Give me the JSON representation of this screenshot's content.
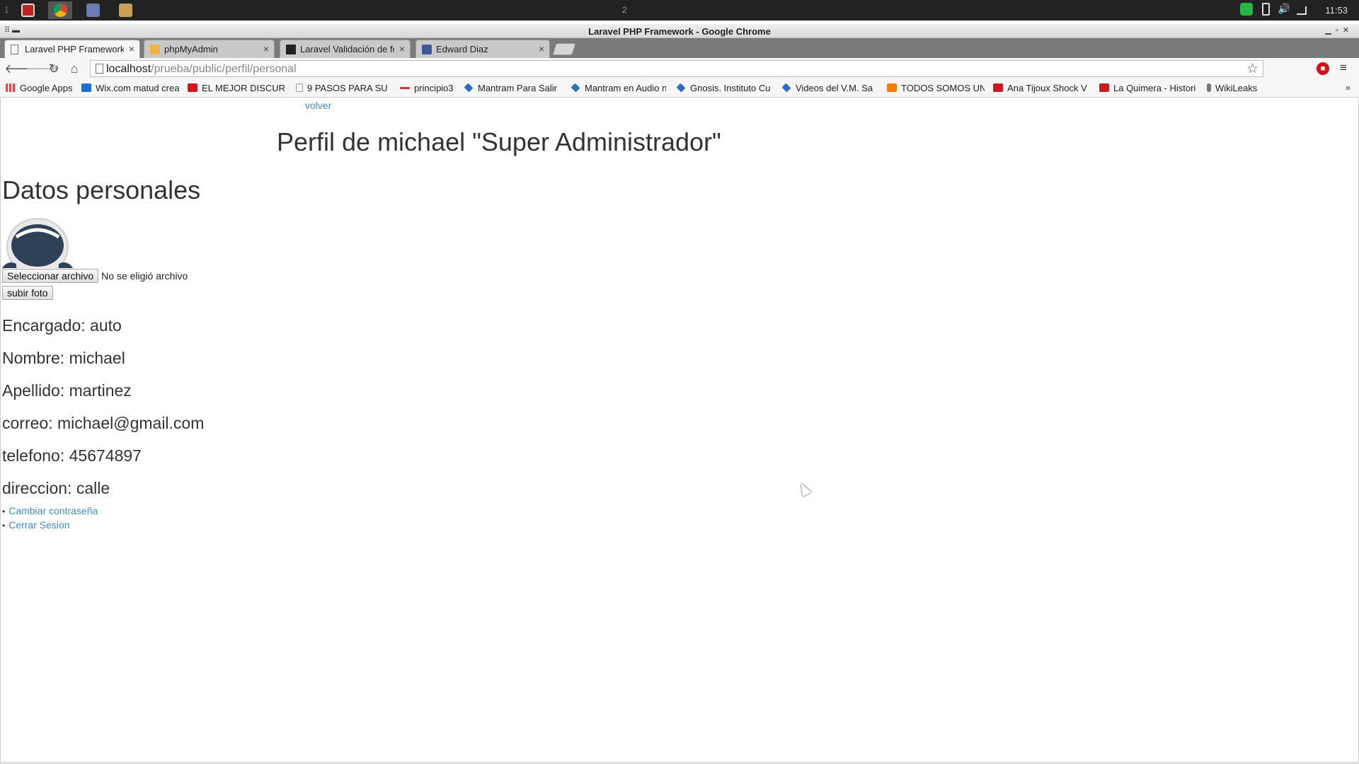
{
  "system": {
    "workspace_1": "1",
    "workspace_2": "2",
    "clock": "11:53"
  },
  "window": {
    "title": "Laravel PHP Framework - Google Chrome"
  },
  "tabs": [
    {
      "label": "Laravel PHP Framework",
      "icon": "page-icon",
      "active": true
    },
    {
      "label": "phpMyAdmin",
      "icon": "phpmyadmin-icon",
      "active": false
    },
    {
      "label": "Laravel Validación de fo",
      "icon": "laravel-icon",
      "active": false
    },
    {
      "label": "Edward Diaz",
      "icon": "facebook-icon",
      "active": false
    }
  ],
  "address_bar": {
    "host": "localhost",
    "path": "/prueba/public/perfil/personal"
  },
  "bookmarks": [
    {
      "label": "Google Apps",
      "icon": "apps-grid-icon",
      "color": "#e44"
    },
    {
      "label": "Wix.com matud crea",
      "icon": "wix-icon",
      "color": "#1d6fd8"
    },
    {
      "label": "EL MEJOR DISCUR",
      "icon": "youtube-icon",
      "color": "#cc181e"
    },
    {
      "label": "9 PASOS PARA SU",
      "icon": "page-icon",
      "color": "#999"
    },
    {
      "label": "principio3",
      "icon": "bookmark-icon",
      "color": "#c33"
    },
    {
      "label": "Mantram Para Salir",
      "icon": "dropbox-icon",
      "color": "#2c6fbf"
    },
    {
      "label": "Mantram en Audio n",
      "icon": "dropbox-icon",
      "color": "#2c6fbf"
    },
    {
      "label": "Gnosis. Instituto Cu",
      "icon": "dropbox-icon",
      "color": "#2c6fbf"
    },
    {
      "label": "Videos del V.M. Sa",
      "icon": "dropbox-icon",
      "color": "#2c6fbf"
    },
    {
      "label": "TODOS SOMOS UN",
      "icon": "blogger-icon",
      "color": "#f57d00"
    },
    {
      "label": "Ana Tijoux Shock V",
      "icon": "youtube-icon",
      "color": "#cc181e"
    },
    {
      "label": "La Quimera - Histori",
      "icon": "youtube-icon",
      "color": "#cc181e"
    },
    {
      "label": "WikiLeaks",
      "icon": "wikileaks-icon",
      "color": "#777"
    }
  ],
  "bookmarks_more": "»",
  "page": {
    "back_link": "volver",
    "title": "Perfil de michael \"Super Administrador\"",
    "section_title": "Datos personales",
    "file_button": "Seleccionar archivo",
    "no_file_text": "No se eligió archivo",
    "upload_button": "subir foto",
    "info": [
      "Encargado: auto",
      "Nombre: michael",
      "Apellido: martinez",
      "correo: michael@gmail.com",
      "telefono: 45674897",
      "direccion: calle"
    ],
    "links": [
      "Cambiar contraseña",
      "Cerrar Sesion"
    ]
  },
  "colors": {
    "link": "#428bca",
    "text": "#333333",
    "tab_strip": "#7a7a7a"
  }
}
